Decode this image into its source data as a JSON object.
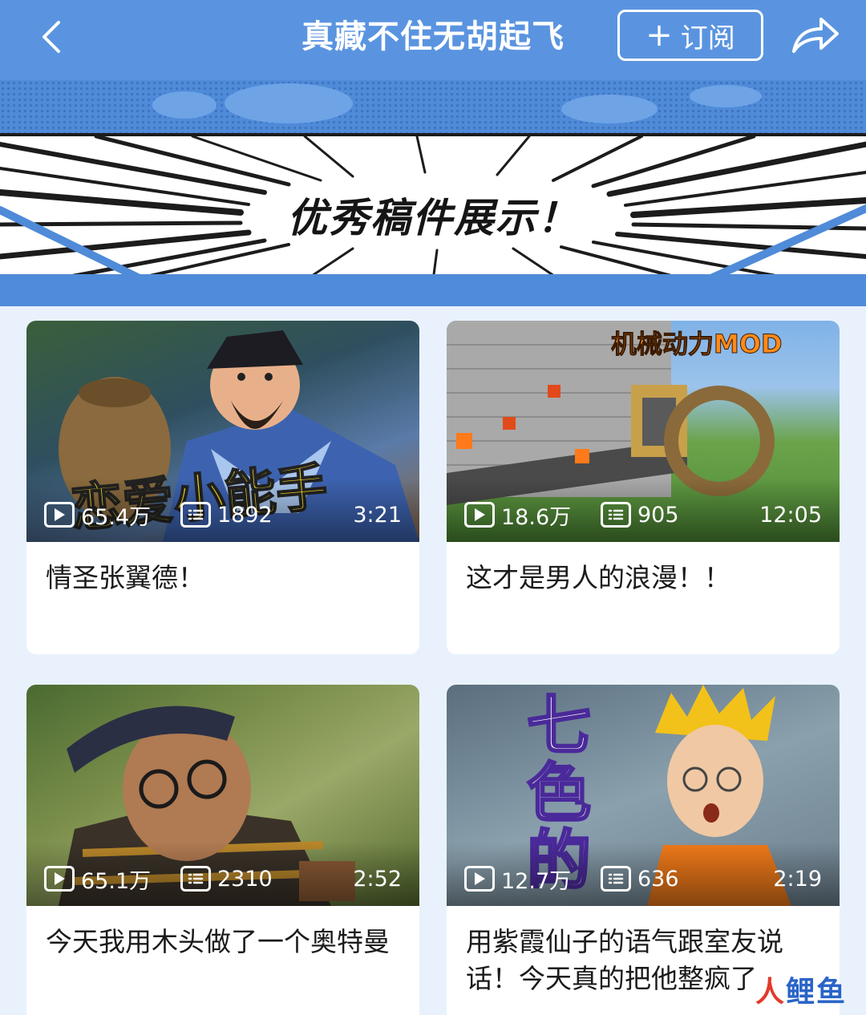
{
  "header": {
    "title": "真藏不住无胡起飞",
    "subscribe_label": "订阅",
    "subscribe_icon": "plus-icon",
    "back_icon": "chevron-left-icon",
    "share_icon": "share-icon",
    "background": "#5a94e0"
  },
  "banner": {
    "title": "优秀稿件展示！"
  },
  "videos": [
    {
      "title": "情圣张翼德！",
      "plays": "65.4万",
      "comments": "1892",
      "duration": "3:21",
      "overlay": "恋爱小能手"
    },
    {
      "title": "这才是男人的浪漫！！",
      "plays": "18.6万",
      "comments": "905",
      "duration": "12:05",
      "overlay": "机械动力MOD"
    },
    {
      "title": "今天我用木头做了一个奥特曼",
      "plays": "65.1万",
      "comments": "2310",
      "duration": "2:52",
      "overlay": ""
    },
    {
      "title": "用紫霞仙子的语气跟室友说话！今天真的把他整疯了",
      "plays": "12.7万",
      "comments": "636",
      "duration": "2:19",
      "overlay": "七色的"
    }
  ],
  "watermark": {
    "part1": "人",
    "part2": "鲤鱼"
  }
}
